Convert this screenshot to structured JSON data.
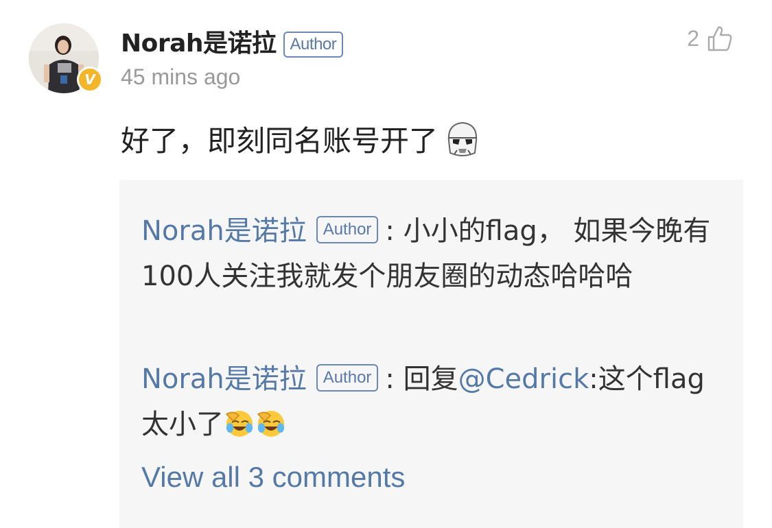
{
  "comment": {
    "username": "Norah是诺拉",
    "author_badge": "Author",
    "verified_badge": "V",
    "timestamp": "45 mins ago",
    "like_count": "2",
    "text": "好了，即刻同名账号开了",
    "text_emoji": "stormtrooper-emoji"
  },
  "replies": [
    {
      "username": "Norah是诺拉",
      "author_badge": "Author",
      "separator": ":",
      "text": "小小的flag， 如果今晚有100人关注我就发个朋友圈的动态哈哈哈"
    },
    {
      "username": "Norah是诺拉",
      "author_badge": "Author",
      "separator": ":",
      "prefix": "回复",
      "mention": "@Cedrick",
      "text": ":这个flag太小了",
      "emojis": [
        "face-palm-laughing-emoji",
        "face-palm-laughing-emoji"
      ]
    }
  ],
  "view_all": "View all 3 comments",
  "colors": {
    "link": "#5479a7",
    "badge_border": "#6b88b4",
    "verified": "#f3b52a",
    "reply_bg": "#f6f6f6",
    "muted": "#999999"
  }
}
